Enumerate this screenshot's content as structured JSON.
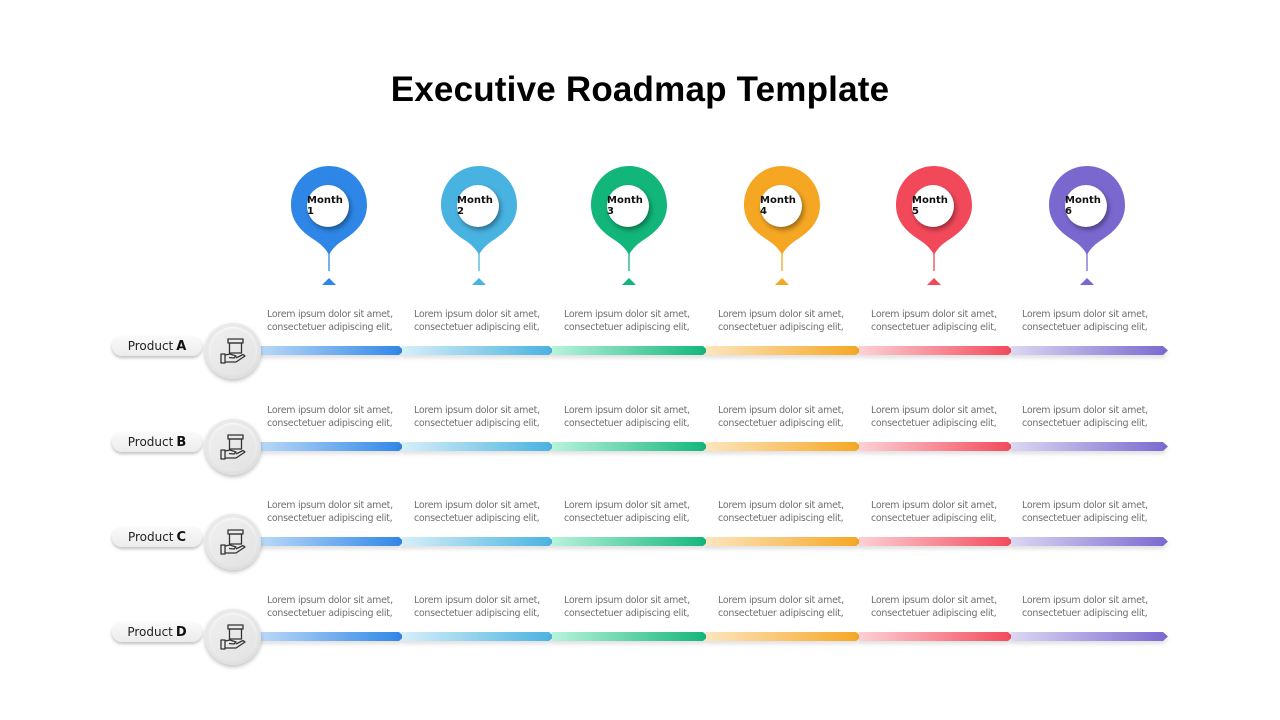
{
  "title": "Executive Roadmap Template",
  "months": [
    {
      "label": "Month 1",
      "color": "#2e86e6",
      "light": "#bcdaf8"
    },
    {
      "label": "Month 2",
      "color": "#48b2e0",
      "light": "#d6eff8"
    },
    {
      "label": "Month 3",
      "color": "#12b57a",
      "light": "#b8f3dc"
    },
    {
      "label": "Month 4",
      "color": "#f5a623",
      "light": "#fde5bd"
    },
    {
      "label": "Month 5",
      "color": "#f2495a",
      "light": "#fdd0d5"
    },
    {
      "label": "Month 6",
      "color": "#7b68cf",
      "light": "#dcd7f2"
    }
  ],
  "products": [
    {
      "prefix": "Product",
      "letter": "A",
      "icon": "hand-holding-box-icon"
    },
    {
      "prefix": "Product",
      "letter": "B",
      "icon": "hand-holding-box-icon"
    },
    {
      "prefix": "Product",
      "letter": "C",
      "icon": "hand-holding-box-icon"
    },
    {
      "prefix": "Product",
      "letter": "D",
      "icon": "hand-holding-box-icon"
    }
  ],
  "description": {
    "line1": "Lorem ipsum dolor sit amet,",
    "line2": "consectetuer adipiscing elit,"
  }
}
